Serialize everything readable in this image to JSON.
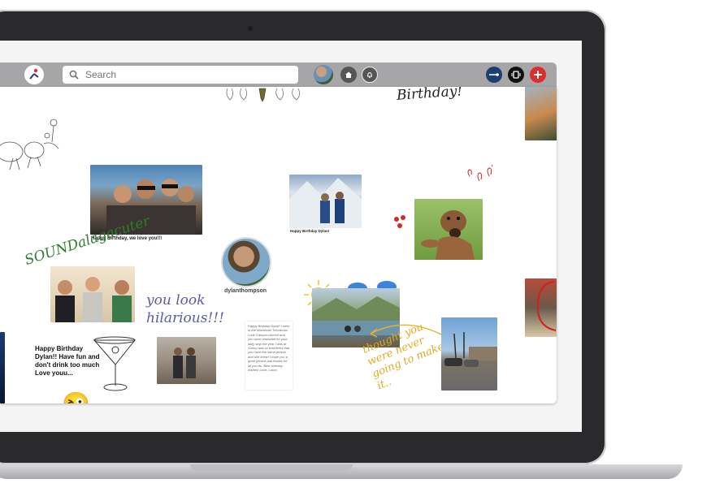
{
  "search": {
    "placeholder": "Search"
  },
  "board": {
    "photo1_caption": "Happy Birthday, we love you!!!",
    "photo2_caption": "Happy Birthday Dylan!",
    "user_name": "dylanthompson",
    "note_text": "Happy Birthday Dylan!! Have fun and don't drink too much Love youu...",
    "handwriting_top": "Birthday!",
    "handwriting_green": "SOUNDalagacuter",
    "handwriting_purple": "you look hilarious!!!",
    "handwriting_yellow": "thought you were never going to make it..",
    "letter_text": "Happy Birthday Dyall!! I went to the Mammoth Tutoramas Lone Canyon concert and you were reminded for your daily stop the year I was at Sunny was so wonderful that you have the same picture and she knew! I hope you a good person and thanks for all you do. Best birthday wishes! Love, Laura",
    "emoji": "😜"
  },
  "colors": {
    "topbar": "#a6a6a8",
    "blue_button": "#1d3e70",
    "add_button": "#e02c2c",
    "laptop_frame": "#2a2a2c"
  }
}
